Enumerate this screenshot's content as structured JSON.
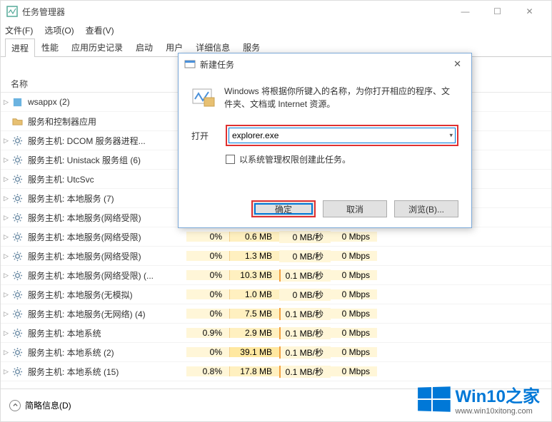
{
  "window": {
    "title": "任务管理器",
    "min": "—",
    "max": "☐",
    "close": "✕"
  },
  "menu": {
    "file": "文件(F)",
    "options": "选项(O)",
    "view": "查看(V)"
  },
  "tabs": {
    "processes": "进程",
    "performance": "性能",
    "app_history": "应用历史记录",
    "startup": "启动",
    "users": "用户",
    "details": "详细信息",
    "services": "服务"
  },
  "columns": {
    "name": "名称"
  },
  "processes": [
    {
      "expand": "▷",
      "icon": "rect",
      "name": "wsappx (2)",
      "cpu": "",
      "mem": "",
      "disk": "",
      "net": ""
    },
    {
      "expand": "",
      "icon": "folder",
      "name": "服务和控制器应用",
      "cpu": "",
      "mem": "",
      "disk": "",
      "net": ""
    },
    {
      "expand": "▷",
      "icon": "gear",
      "name": "服务主机: DCOM 服务器进程...",
      "cpu": "",
      "mem": "",
      "disk": "",
      "net": ""
    },
    {
      "expand": "▷",
      "icon": "gear",
      "name": "服务主机: Unistack 服务组 (6)",
      "cpu": "",
      "mem": "",
      "disk": "",
      "net": ""
    },
    {
      "expand": "▷",
      "icon": "gear",
      "name": "服务主机: UtcSvc",
      "cpu": "",
      "mem": "",
      "disk": "",
      "net": ""
    },
    {
      "expand": "▷",
      "icon": "gear",
      "name": "服务主机: 本地服务 (7)",
      "cpu": "",
      "mem": "",
      "disk": "",
      "net": ""
    },
    {
      "expand": "▷",
      "icon": "gear",
      "name": "服务主机: 本地服务(网络受限)",
      "cpu": "",
      "mem": "",
      "disk": "",
      "net": ""
    },
    {
      "expand": "▷",
      "icon": "gear",
      "name": "服务主机: 本地服务(网络受限)",
      "cpu": "0%",
      "mem": "0.6 MB",
      "disk": "0 MB/秒",
      "net": "0 Mbps"
    },
    {
      "expand": "▷",
      "icon": "gear",
      "name": "服务主机: 本地服务(网络受限)",
      "cpu": "0%",
      "mem": "1.3 MB",
      "disk": "0 MB/秒",
      "net": "0 Mbps"
    },
    {
      "expand": "▷",
      "icon": "gear",
      "name": "服务主机: 本地服务(网络受限) (...",
      "cpu": "0%",
      "mem": "10.3 MB",
      "disk": "0.1 MB/秒",
      "net": "0 Mbps",
      "diskBordered": true
    },
    {
      "expand": "▷",
      "icon": "gear",
      "name": "服务主机: 本地服务(无模拟)",
      "cpu": "0%",
      "mem": "1.0 MB",
      "disk": "0 MB/秒",
      "net": "0 Mbps"
    },
    {
      "expand": "▷",
      "icon": "gear",
      "name": "服务主机: 本地服务(无网络) (4)",
      "cpu": "0%",
      "mem": "7.5 MB",
      "disk": "0.1 MB/秒",
      "net": "0 Mbps",
      "diskBordered": true
    },
    {
      "expand": "▷",
      "icon": "gear",
      "name": "服务主机: 本地系统",
      "cpu": "0.9%",
      "mem": "2.9 MB",
      "disk": "0.1 MB/秒",
      "net": "0 Mbps",
      "diskBordered": true
    },
    {
      "expand": "▷",
      "icon": "gear",
      "name": "服务主机: 本地系统 (2)",
      "cpu": "0%",
      "mem": "39.1 MB",
      "disk": "0.1 MB/秒",
      "net": "0 Mbps",
      "diskBordered": true,
      "memDark": true
    },
    {
      "expand": "▷",
      "icon": "gear",
      "name": "服务主机: 本地系统 (15)",
      "cpu": "0.8%",
      "mem": "17.8 MB",
      "disk": "0.1 MB/秒",
      "net": "0 Mbps",
      "diskBordered": true
    }
  ],
  "bottom": {
    "fewer": "简略信息(D)"
  },
  "dialog": {
    "title": "新建任务",
    "desc": "Windows 将根据你所键入的名称，为你打开相应的程序、文件夹、文档或 Internet 资源。",
    "open_label": "打开",
    "open_value": "explorer.exe",
    "admin_check": "以系统管理权限创建此任务。",
    "ok": "确定",
    "cancel": "取消",
    "browse": "浏览(B)...",
    "close": "✕"
  },
  "watermark": {
    "brand": "Win10",
    "sub": "之家",
    "url": "www.win10xitong.com"
  }
}
